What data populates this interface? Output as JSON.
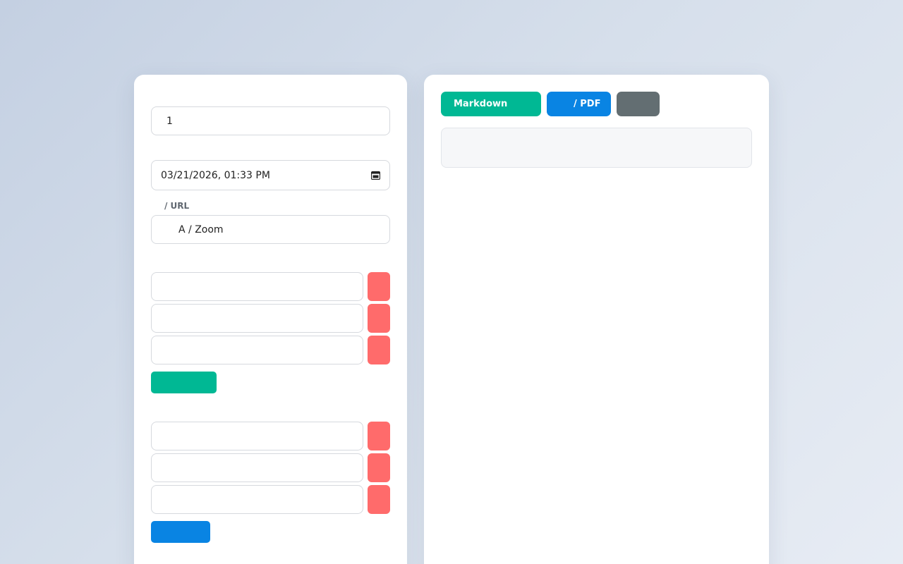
{
  "form": {
    "title_value": "1",
    "datetime_value": "03/21/2026, 01:33 PM",
    "location_label": "/ URL",
    "location_value": "A / Zoom",
    "list_one": {
      "rows": [
        "",
        "",
        ""
      ],
      "add_label": ""
    },
    "list_two": {
      "rows": [
        "",
        "",
        ""
      ],
      "add_label": ""
    }
  },
  "toolbar": {
    "markdown_label": "Markdown",
    "pdf_label": "/ PDF",
    "third_label": ""
  },
  "preview": {
    "content": ""
  },
  "icons": {
    "datetime": "calendar-icon"
  },
  "colors": {
    "remove": "#ff6b6b",
    "add_primary": "#00b894",
    "add_secondary": "#0984e3",
    "toolbar_markdown": "#00b894",
    "toolbar_pdf": "#0984e3",
    "toolbar_third": "#636e72"
  }
}
